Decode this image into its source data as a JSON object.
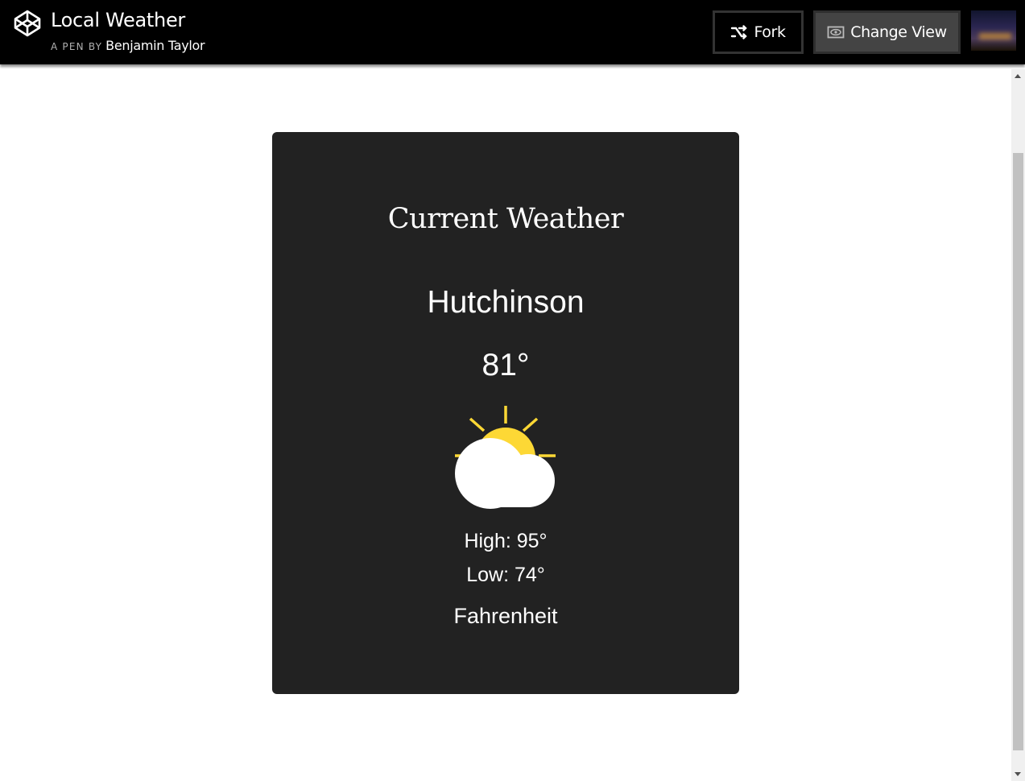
{
  "header": {
    "title": "Local Weather",
    "byline_prefix": "A PEN BY",
    "author": "Benjamin Taylor",
    "fork_label": "Fork",
    "change_view_label": "Change View"
  },
  "weather": {
    "heading": "Current Weather",
    "city": "Hutchinson",
    "temperature": "81°",
    "condition_icon": "partly-cloudy-icon",
    "high": "High: 95°",
    "low": "Low: 74°",
    "unit": "Fahrenheit"
  },
  "colors": {
    "topbar": "#000000",
    "card": "#222222",
    "sun": "#fdd835",
    "cloud": "#ffffff"
  }
}
